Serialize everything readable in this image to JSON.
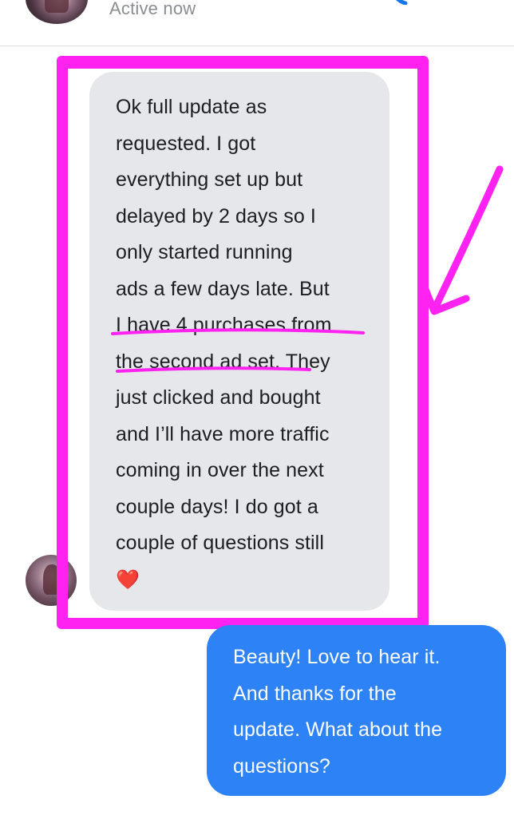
{
  "header": {
    "status": "Active now",
    "call_icon": "phone-icon",
    "video_icon": "video-camera-icon",
    "accent": "#1877f2"
  },
  "conversation": {
    "incoming": {
      "lines": [
        "Ok full update as",
        "requested. I got",
        "everything set up but",
        "delayed by 2 days so I",
        "only started running",
        "ads a few days late. But",
        "I have 4 purchases from",
        "the second ad set. They",
        "just clicked and bought",
        "and I’ll have more traffic",
        "coming in over the next",
        "couple days! I do got a",
        "couple of questions still"
      ],
      "emoji": "❤️",
      "bubble_color": "#e6e7eb"
    },
    "outgoing": {
      "lines": [
        "Beauty! Love to hear it.",
        "And thanks for the",
        "update. What about the",
        "questions?"
      ],
      "bubble_color": "#2d82f5"
    }
  },
  "annotations": {
    "color": "#ff22f0",
    "frame": "highlight-frame",
    "arrow": "pointing-arrow",
    "underlines": [
      "I have 4 purchases from",
      "the second ad set."
    ]
  }
}
